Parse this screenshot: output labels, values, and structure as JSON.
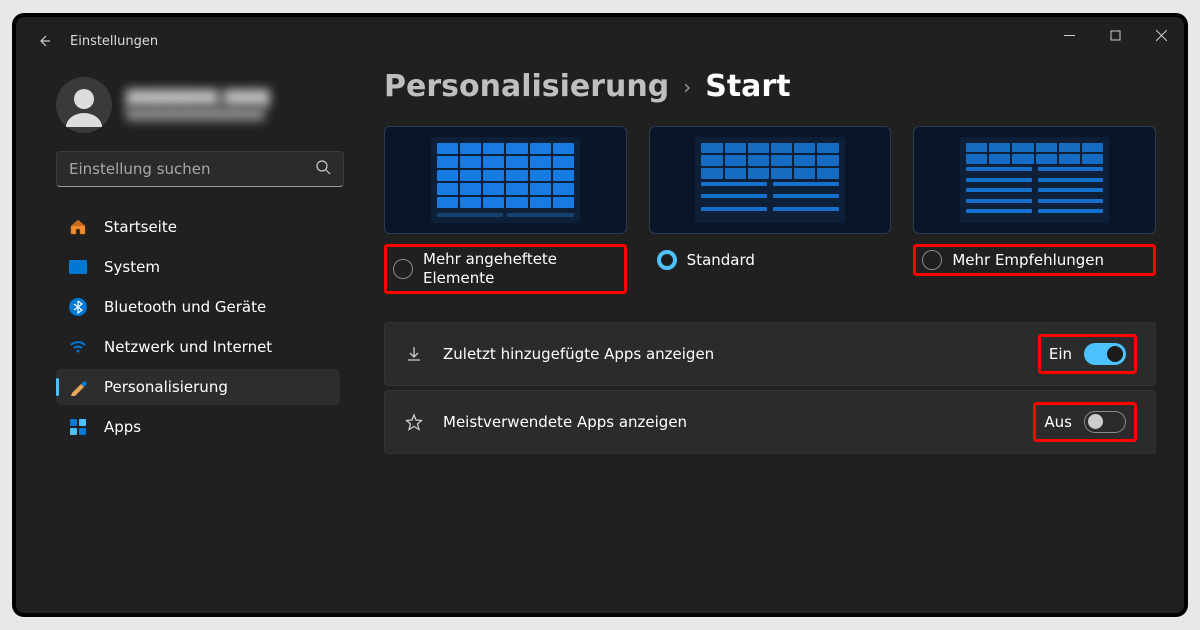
{
  "app_title": "Einstellungen",
  "profile": {
    "name": "████████ ████",
    "email": "███████████████"
  },
  "search": {
    "placeholder": "Einstellung suchen"
  },
  "sidebar": {
    "items": [
      {
        "label": "Startseite"
      },
      {
        "label": "System"
      },
      {
        "label": "Bluetooth und Geräte"
      },
      {
        "label": "Netzwerk und Internet"
      },
      {
        "label": "Personalisierung"
      },
      {
        "label": "Apps"
      }
    ]
  },
  "breadcrumb": {
    "parent": "Personalisierung",
    "current": "Start"
  },
  "layouts": [
    {
      "label": "Mehr angeheftete Elemente",
      "checked": false,
      "highlight": true
    },
    {
      "label": "Standard",
      "checked": true,
      "highlight": false
    },
    {
      "label": "Mehr Empfehlungen",
      "checked": false,
      "highlight": true
    }
  ],
  "settings": [
    {
      "label": "Zuletzt hinzugefügte Apps anzeigen",
      "state_label": "Ein",
      "on": true
    },
    {
      "label": "Meistverwendete Apps anzeigen",
      "state_label": "Aus",
      "on": false
    }
  ]
}
